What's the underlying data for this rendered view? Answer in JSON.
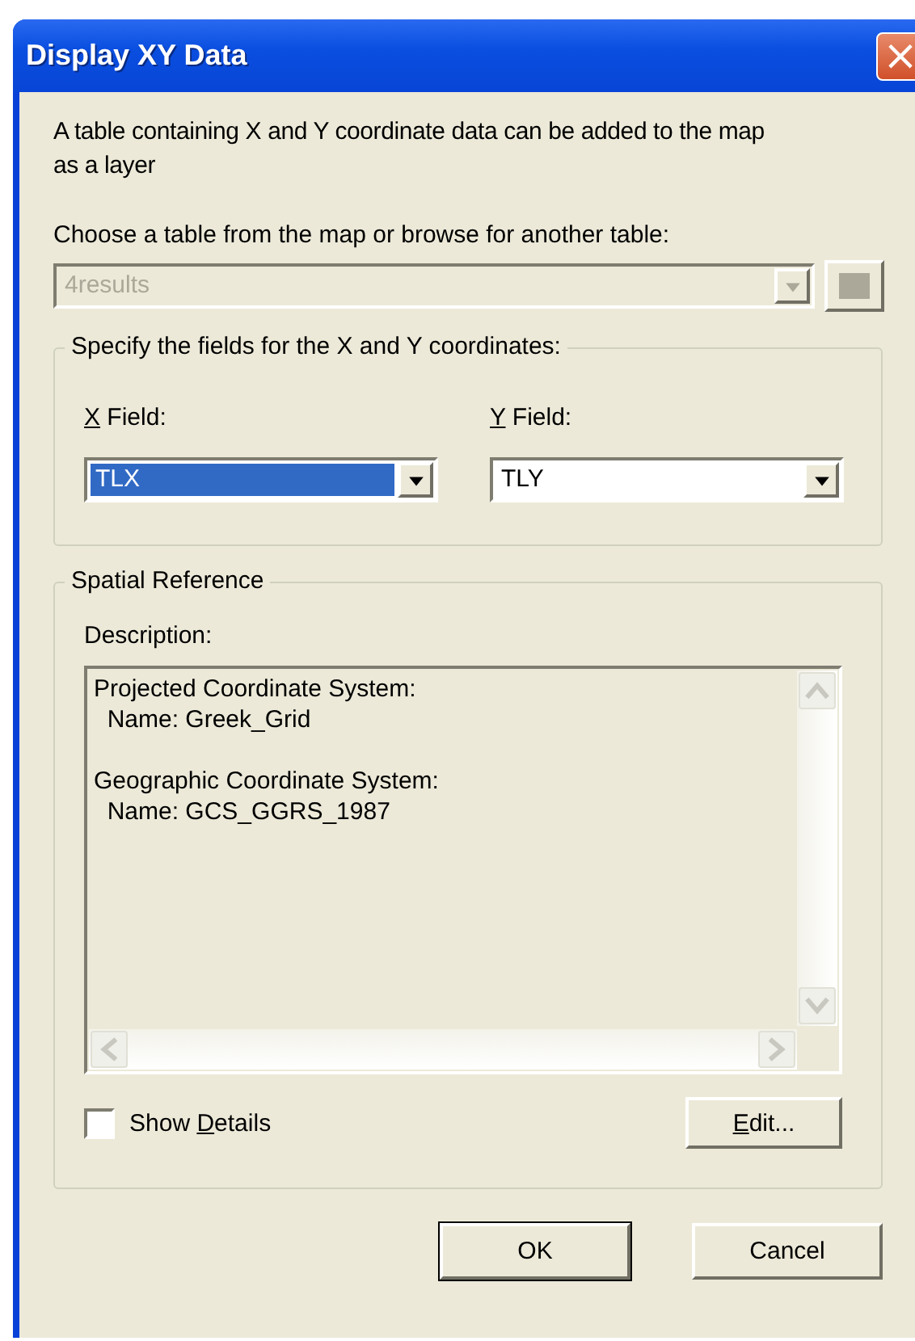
{
  "window": {
    "title": "Display XY Data",
    "close": "×"
  },
  "intro": "A table containing X and Y coordinate data can be added to the map as a layer",
  "table_chooser": {
    "label": "Choose a table from the map or browse for another table:",
    "value": "4results",
    "disabled": true
  },
  "fields_group": {
    "title": "Specify the fields for the X and Y coordinates:",
    "fields": [
      {
        "label": {
          "key": "X",
          "after": " Field:"
        },
        "value": "TLX",
        "focused": true
      },
      {
        "label": {
          "key": "Y",
          "after": " Field:"
        },
        "value": "TLY",
        "focused": false
      }
    ]
  },
  "spatial_reference": {
    "title": "Spatial Reference",
    "description_label": "Description:",
    "description_blocks": [
      {
        "lines": [
          "Projected Coordinate System:",
          "  Name: Greek_Grid"
        ]
      },
      {
        "lines": [
          "Geographic Coordinate System:",
          "  Name: GCS_GGRS_1987"
        ]
      }
    ],
    "show_details": {
      "label": {
        "before": "Show ",
        "key": "D",
        "after": "etails"
      },
      "checked": false
    },
    "edit_button": {
      "label": {
        "key": "E",
        "after": "dit..."
      }
    }
  },
  "buttons": [
    {
      "label": "OK",
      "default": true
    },
    {
      "label": "Cancel",
      "default": false
    }
  ]
}
